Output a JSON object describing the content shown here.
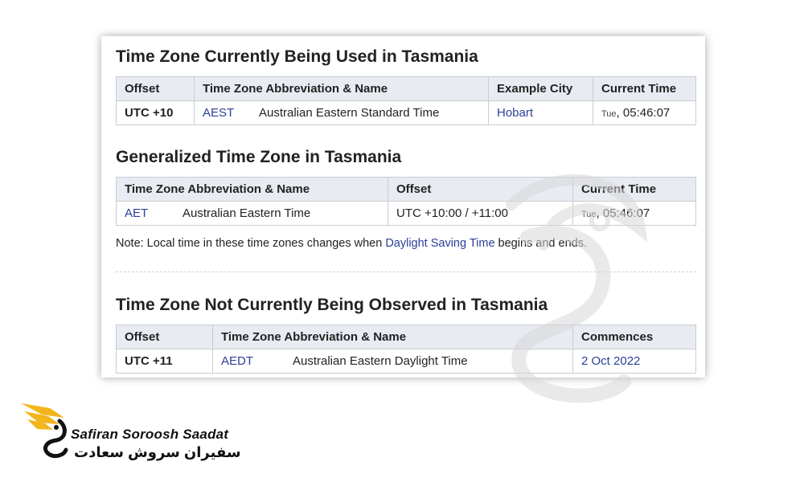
{
  "section1": {
    "title": "Time Zone Currently Being Used in Tasmania",
    "headers": [
      "Offset",
      "Time Zone Abbreviation & Name",
      "Example City",
      "Current Time"
    ],
    "row": {
      "offset": "UTC +10",
      "abbr": "AEST",
      "name": "Australian Eastern Standard Time",
      "city": "Hobart",
      "day": "Tue",
      "time": ", 05:46:07"
    }
  },
  "section2": {
    "title": "Generalized Time Zone in Tasmania",
    "headers": [
      "Time Zone Abbreviation & Name",
      "Offset",
      "Current Time"
    ],
    "row": {
      "abbr": "AET",
      "name": "Australian Eastern Time",
      "offset": "UTC +10:00 / +11:00",
      "day": "Tue",
      "time": ", 05:46:07"
    }
  },
  "note": {
    "prefix": "Note: Local time in these time zones changes when ",
    "link": "Daylight Saving Time",
    "suffix": " begins and ends."
  },
  "section3": {
    "title": "Time Zone Not Currently Being Observed in Tasmania",
    "headers": [
      "Offset",
      "Time Zone Abbreviation & Name",
      "Commences"
    ],
    "row": {
      "offset": "UTC +11",
      "abbr": "AEDT",
      "name": "Australian Eastern Daylight Time",
      "commences": "2 Oct 2022"
    }
  },
  "brand": {
    "name_en": "Safiran Soroosh Saadat",
    "name_fa": "سفیران سروش سعادت",
    "gold": "#f2b51c",
    "dark": "#111111",
    "link_color": "#2a3f97"
  }
}
